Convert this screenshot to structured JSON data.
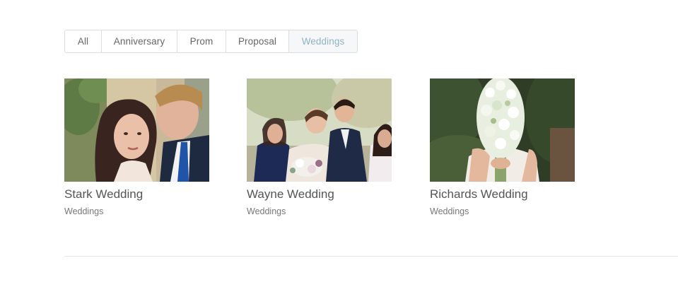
{
  "filters": [
    {
      "label": "All",
      "active": false
    },
    {
      "label": "Anniversary",
      "active": false
    },
    {
      "label": "Prom",
      "active": false
    },
    {
      "label": "Proposal",
      "active": false
    },
    {
      "label": "Weddings",
      "active": true
    }
  ],
  "portfolio": [
    {
      "title": "Stark Wedding",
      "category": "Weddings",
      "image": "couple-portrait-photo"
    },
    {
      "title": "Wayne Wedding",
      "category": "Weddings",
      "image": "wedding-party-photo"
    },
    {
      "title": "Richards Wedding",
      "category": "Weddings",
      "image": "bride-bouquet-photo"
    }
  ],
  "colors": {
    "active_filter_text": "#8fb3c8",
    "active_filter_bg": "#f6f7f8",
    "border": "#dcdcdc",
    "divider": "#e6e6e6"
  }
}
